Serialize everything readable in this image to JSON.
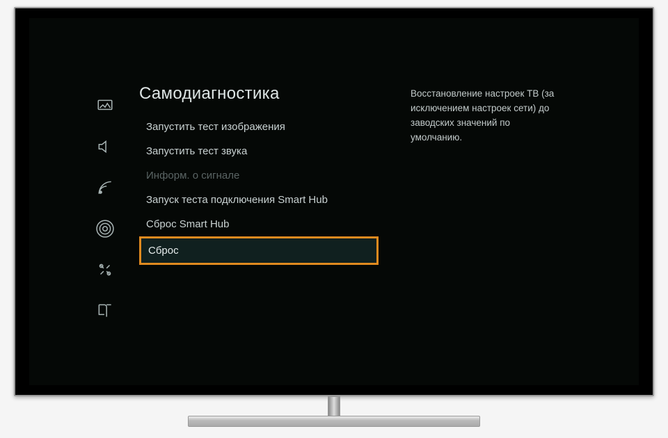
{
  "sidebar": {
    "items": [
      {
        "name": "picture-icon"
      },
      {
        "name": "sound-icon"
      },
      {
        "name": "broadcast-icon"
      },
      {
        "name": "network-icon"
      },
      {
        "name": "support-icon"
      },
      {
        "name": "help-icon"
      }
    ]
  },
  "menu": {
    "title": "Самодиагностика",
    "items": [
      {
        "label": "Запустить тест изображения",
        "disabled": false,
        "selected": false
      },
      {
        "label": "Запустить тест звука",
        "disabled": false,
        "selected": false
      },
      {
        "label": "Информ. о сигнале",
        "disabled": true,
        "selected": false
      },
      {
        "label": "Запуск теста подключения Smart Hub",
        "disabled": false,
        "selected": false
      },
      {
        "label": "Сброс Smart Hub",
        "disabled": false,
        "selected": false
      },
      {
        "label": "Сброс",
        "disabled": false,
        "selected": true
      }
    ]
  },
  "description": "Восстановление настроек ТВ (за исключением настроек сети) до заводских значений по умолчанию."
}
